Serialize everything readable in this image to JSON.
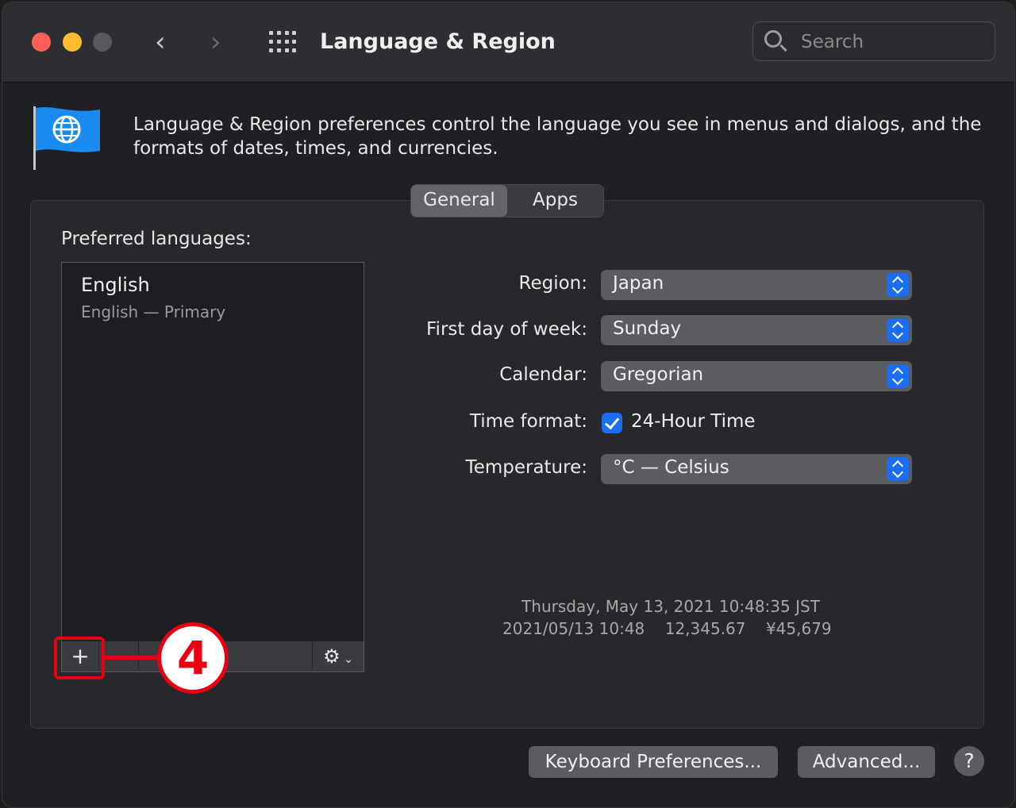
{
  "window": {
    "title": "Language & Region"
  },
  "search": {
    "placeholder": "Search"
  },
  "description": "Language & Region preferences control the language you see in menus and dialogs, and the formats of dates, times, and currencies.",
  "tabs": [
    {
      "label": "General",
      "active": true
    },
    {
      "label": "Apps",
      "active": false
    }
  ],
  "preferred_languages": {
    "label": "Preferred languages:",
    "items": [
      {
        "name": "English",
        "sub": "English — Primary"
      }
    ],
    "add_label": "+"
  },
  "annotation": {
    "number": "4",
    "color": "#e60012"
  },
  "settings": {
    "region": {
      "label": "Region:",
      "value": "Japan"
    },
    "first_day": {
      "label": "First day of week:",
      "value": "Sunday"
    },
    "calendar": {
      "label": "Calendar:",
      "value": "Gregorian"
    },
    "time_format": {
      "label": "Time format:",
      "checkbox_label": "24-Hour Time",
      "checked": true
    },
    "temperature": {
      "label": "Temperature:",
      "value": "°C — Celsius"
    }
  },
  "sample": {
    "line1": "Thursday, May 13, 2021 10:48:35 JST",
    "date_short": "2021/05/13 10:48",
    "number": "12,345.67",
    "currency": "¥45,679"
  },
  "buttons": {
    "keyboard": "Keyboard Preferences...",
    "advanced": "Advanced...",
    "help": "?"
  },
  "colors": {
    "accent": "#1b6ef3"
  }
}
